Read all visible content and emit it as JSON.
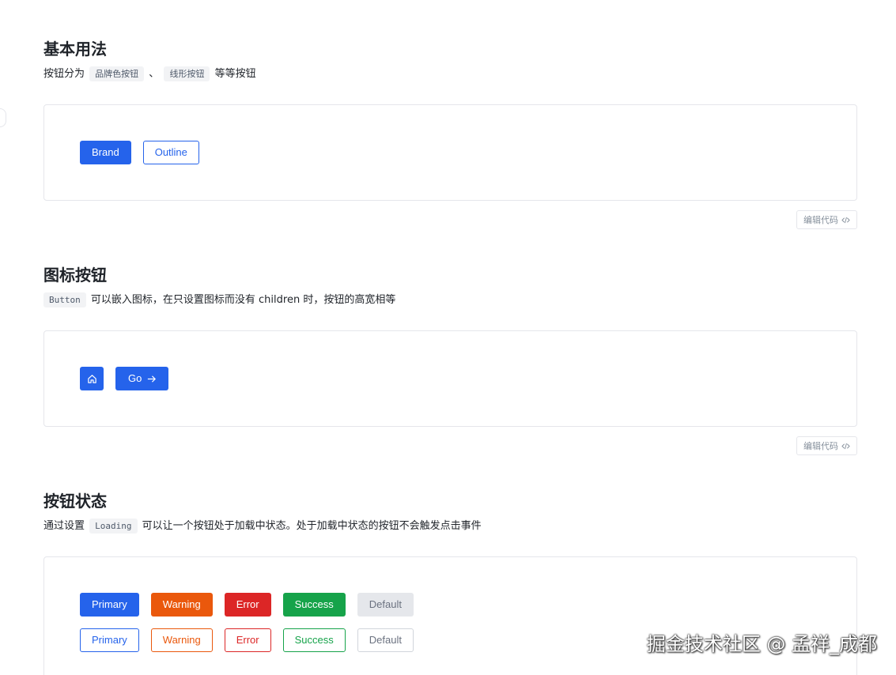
{
  "colors": {
    "brand": "#2563eb",
    "warning": "#ea580c",
    "error": "#dc2626",
    "success": "#16a34a",
    "default": "#6b7280"
  },
  "basic": {
    "title": "基本用法",
    "desc_before": "按钮分为",
    "code1": "品牌色按钮",
    "sep": "、",
    "code2": "线形按钮",
    "desc_after": "等等按钮",
    "brand_label": "Brand",
    "outline_label": "Outline",
    "edit_label": "编辑代码",
    "edit_icon": "code-icon"
  },
  "icon_section": {
    "title": "图标按钮",
    "code": "Button",
    "desc": "可以嵌入图标，在只设置图标而没有 children 时，按钮的高宽相等",
    "home_icon": "home-icon",
    "go_label": "Go",
    "go_icon": "arrow-right-icon",
    "edit_label": "编辑代码"
  },
  "state_section": {
    "title": "按钮状态",
    "desc_before": "通过设置",
    "code": "Loading",
    "desc_after": "可以让一个按钮处于加载中状态。处于加载中状态的按钮不会触发点击事件",
    "labels": [
      "Primary",
      "Warning",
      "Error",
      "Success",
      "Default"
    ]
  },
  "watermark": "掘金技术社区 @ 孟祥_成都"
}
